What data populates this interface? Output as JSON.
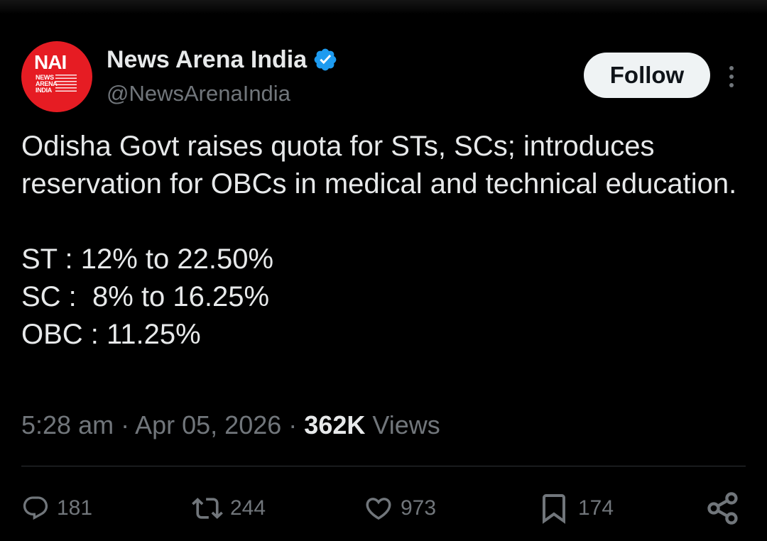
{
  "account": {
    "avatar_initials": "NAI",
    "avatar_sub": [
      "NEWS",
      "ARENA",
      "INDIA"
    ],
    "display_name": "News Arena India",
    "handle": "@NewsArenaIndia",
    "verified": true
  },
  "follow_label": "Follow",
  "tweet": {
    "text": "Odisha Govt raises quota for STs, SCs; introduces reservation for OBCs in medical and technical education.\n\nST : 12% to 22.50%\nSC :  8% to 16.25%\nOBC : 11.25%"
  },
  "meta": {
    "time": "5:28 am",
    "separator": "·",
    "date": "Apr 05, 2026",
    "views_count": "362K",
    "views_label": "Views"
  },
  "actions": {
    "replies": "181",
    "reposts": "244",
    "likes": "973",
    "bookmarks": "174"
  },
  "icons": {
    "verified": "verified-badge-icon",
    "more": "more-vertical-icon",
    "reply": "reply-icon",
    "repost": "repost-icon",
    "like": "heart-icon",
    "bookmark": "bookmark-icon",
    "share": "share-icon"
  },
  "colors": {
    "background": "#000000",
    "text": "#e7e9ea",
    "secondary_text": "#71767b",
    "verified_blue": "#1d9bf0",
    "avatar_red": "#e61c23",
    "follow_bg": "#eff3f4"
  }
}
